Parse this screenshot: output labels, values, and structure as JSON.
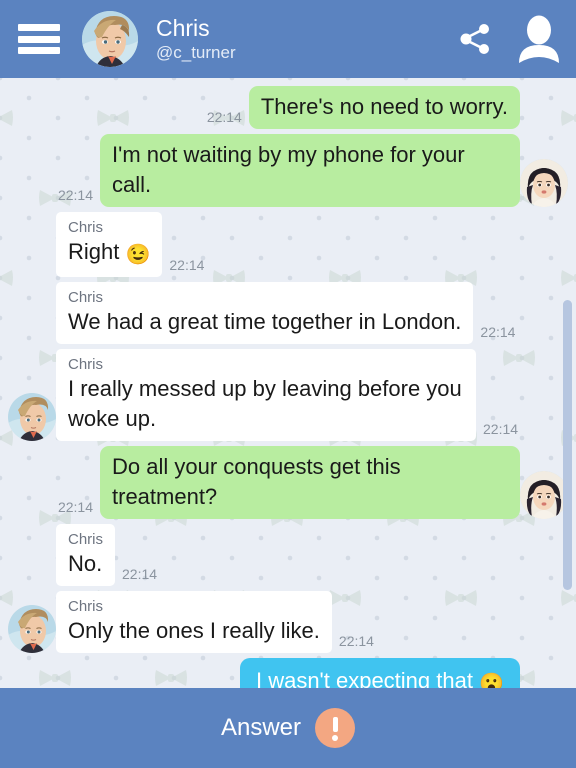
{
  "header": {
    "menu_icon": "hamburger-menu-icon",
    "avatar_alt": "chris-avatar",
    "name": "Chris",
    "handle": "@c_turner",
    "share_icon": "share-icon",
    "profile_icon": "person-icon",
    "background_color": "#5b83c0"
  },
  "chat": {
    "background_color": "#eaeef5",
    "incoming_bubble_color": "#ffffff",
    "outgoing_bubble_color": "#b8eda0",
    "self_bubble_color": "#40c4f0",
    "timestamp_color": "#8b949f",
    "messages": [
      {
        "side": "right",
        "style": "out",
        "sender": "",
        "text": "There's no need to worry.",
        "emoji": "",
        "time": "22:14",
        "avatar": ""
      },
      {
        "side": "right",
        "style": "out",
        "sender": "",
        "text": "I'm not waiting by my phone for your call.",
        "emoji": "",
        "time": "22:14",
        "avatar": "female"
      },
      {
        "side": "left",
        "style": "in",
        "sender": "Chris",
        "text": "Right",
        "emoji": "😉",
        "time": "22:14",
        "avatar": ""
      },
      {
        "side": "left",
        "style": "in",
        "sender": "Chris",
        "text": "We had a great time together in London.",
        "emoji": "",
        "time": "22:14",
        "avatar": ""
      },
      {
        "side": "left",
        "style": "in",
        "sender": "Chris",
        "text": "I really messed up by leaving before you woke up.",
        "emoji": "",
        "time": "22:14",
        "avatar": "male"
      },
      {
        "side": "right",
        "style": "out",
        "sender": "",
        "text": "Do all your conquests get this treatment?",
        "emoji": "",
        "time": "22:14",
        "avatar": "female"
      },
      {
        "side": "left",
        "style": "in",
        "sender": "Chris",
        "text": "No.",
        "emoji": "",
        "time": "22:14",
        "avatar": ""
      },
      {
        "side": "left",
        "style": "in",
        "sender": "Chris",
        "text": "Only the ones I really like.",
        "emoji": "",
        "time": "22:14",
        "avatar": "male"
      },
      {
        "side": "right",
        "style": "self",
        "sender": "",
        "text": "I wasn't expecting that",
        "emoji": "😮",
        "time": "",
        "avatar": ""
      }
    ]
  },
  "scrollbar": {
    "name": "chat-scrollbar"
  },
  "bottom_bar": {
    "answer_label": "Answer",
    "badge_icon": "exclamation-icon",
    "badge_color": "#f3a782",
    "background_color": "#5b83c0"
  }
}
